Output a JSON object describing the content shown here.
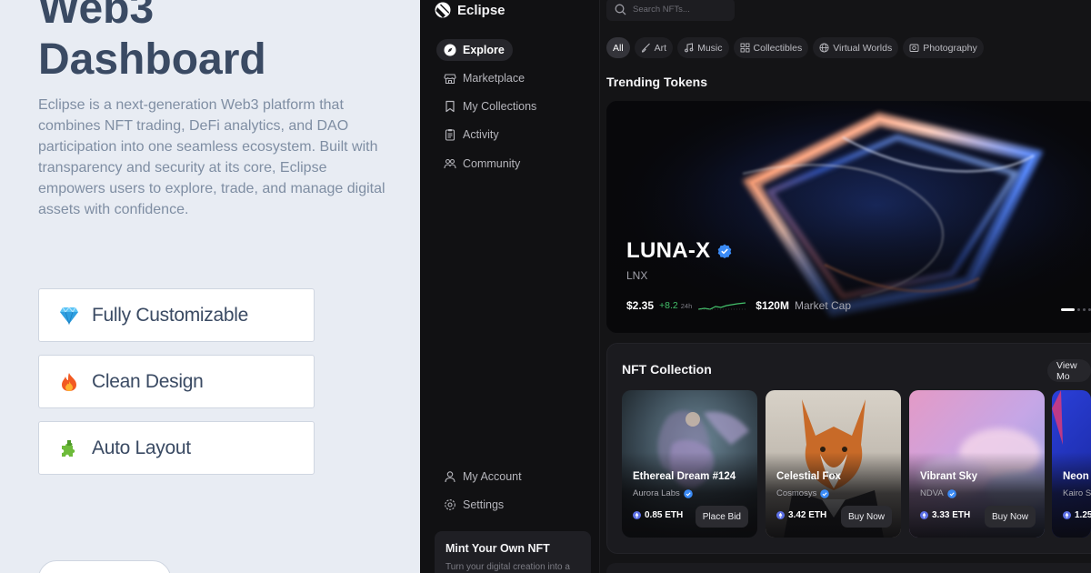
{
  "promo": {
    "title_line1": "Web3",
    "title_line2": "Dashboard",
    "description": "Eclipse is a next-generation Web3 platform that combines NFT trading, DeFi analytics, and DAO participation into one seamless ecosystem. Built with transparency and security at its core, Eclipse empowers users to explore, trade, and manage digital assets with confidence.",
    "features": [
      {
        "label": "Fully Customizable",
        "icon": "gem-icon"
      },
      {
        "label": "Clean Design",
        "icon": "fire-icon"
      },
      {
        "label": "Auto Layout",
        "icon": "puzzle-icon"
      }
    ]
  },
  "app": {
    "brand": "Eclipse",
    "search_placeholder": "Search NFTs...",
    "nav": [
      {
        "label": "Explore",
        "icon": "compass-icon",
        "active": true
      },
      {
        "label": "Marketplace",
        "icon": "store-icon"
      },
      {
        "label": "My Collections",
        "icon": "bookmark-icon"
      },
      {
        "label": "Activity",
        "icon": "clipboard-icon"
      },
      {
        "label": "Community",
        "icon": "users-icon"
      }
    ],
    "nav_bottom": [
      {
        "label": "My Account",
        "icon": "user-icon"
      },
      {
        "label": "Settings",
        "icon": "gear-icon"
      }
    ],
    "mint": {
      "title": "Mint Your Own NFT",
      "subtitle": "Turn your digital creation into a"
    },
    "categories": [
      {
        "label": "All",
        "active": true
      },
      {
        "label": "Art",
        "icon": "brush-icon"
      },
      {
        "label": "Music",
        "icon": "music-icon"
      },
      {
        "label": "Collectibles",
        "icon": "grid-icon"
      },
      {
        "label": "Virtual Worlds",
        "icon": "globe-icon"
      },
      {
        "label": "Photography",
        "icon": "camera-icon"
      }
    ],
    "trending": {
      "title": "Trending Tokens",
      "token_name": "LUNA-X",
      "token_symbol": "LNX",
      "price": "$2.35",
      "change": "+8.2",
      "period": "24h",
      "market_cap": "$120M",
      "market_cap_label": "Market Cap",
      "slide_count": 4,
      "active_slide": 1
    },
    "collection": {
      "title": "NFT Collection",
      "view_more": "View Mo",
      "items": [
        {
          "name": "Ethereal Dream #124",
          "creator": "Aurora Labs",
          "price": "0.85 ETH",
          "action": "Place Bid"
        },
        {
          "name": "Celestial Fox",
          "creator": "Cosmosys",
          "price": "3.42 ETH",
          "action": "Buy Now"
        },
        {
          "name": "Vibrant Sky",
          "creator": "NDVA",
          "price": "3.33 ETH",
          "action": "Buy Now"
        },
        {
          "name": "Neon S",
          "creator": "Kairo S",
          "price": "1.25",
          "action": ""
        }
      ]
    },
    "colors": {
      "accent_green": "#43c06a",
      "verified_blue": "#3b8bf6",
      "background": "#141416"
    }
  }
}
